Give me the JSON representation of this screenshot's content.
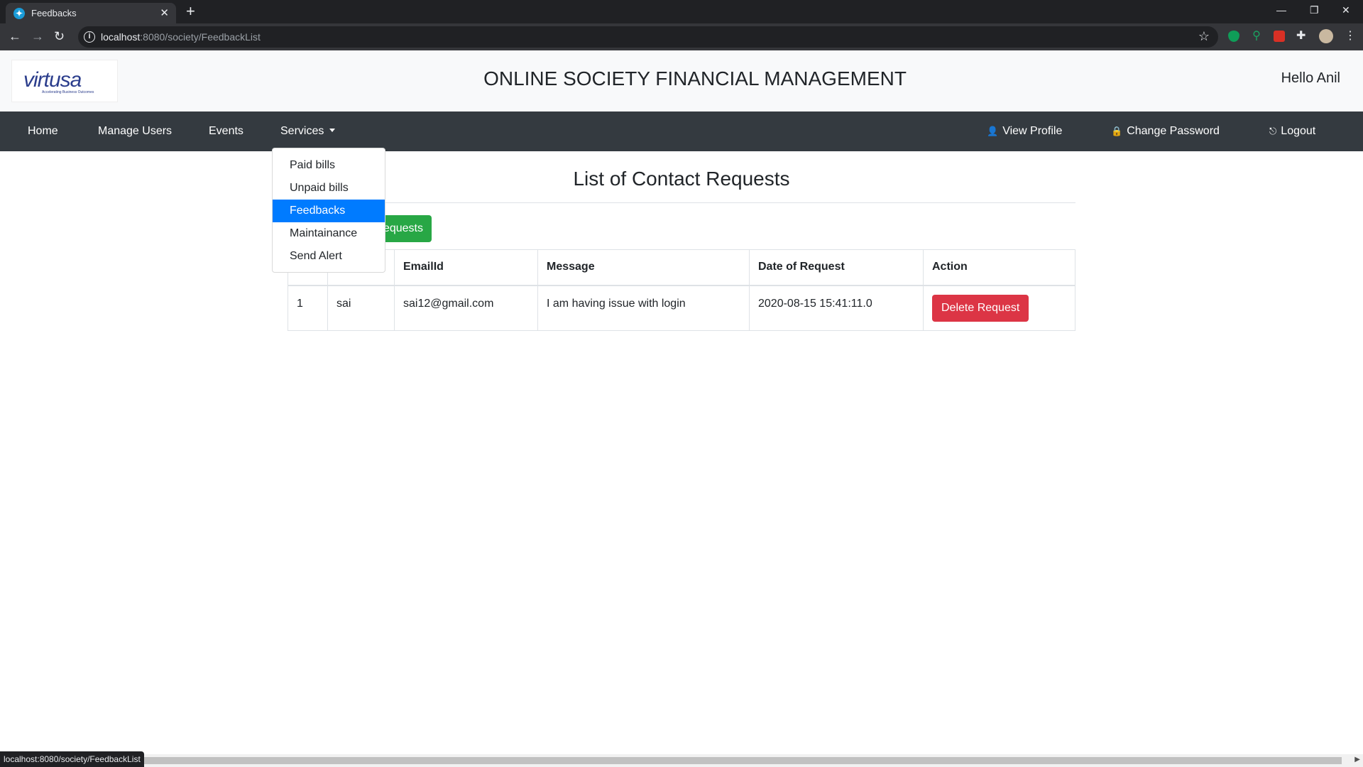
{
  "browser": {
    "tab_title": "Feedbacks",
    "tab_close": "✕",
    "new_tab": "+",
    "url_host": "localhost",
    "url_path": ":8080/society/FeedbackList",
    "status_url": "localhost:8080/society/FeedbackList",
    "win_minimize": "—",
    "win_restore": "❐",
    "win_close": "✕"
  },
  "header": {
    "logo_text": "virtusa",
    "logo_tagline": "Accelerating Business Outcomes",
    "title": "ONLINE SOCIETY FINANCIAL MANAGEMENT",
    "greeting": "Hello Anil"
  },
  "nav": {
    "home": "Home",
    "manage_users": "Manage Users",
    "events": "Events",
    "services": "Services",
    "view_profile": "View Profile",
    "change_password": "Change Password",
    "logout": "Logout"
  },
  "services_menu": {
    "items": [
      "Paid bills",
      "Unpaid bills",
      "Feedbacks",
      "Maintainance",
      "Send Alert"
    ],
    "active": "Feedbacks"
  },
  "main": {
    "title": "List of Contact Requests",
    "green_button_visible": "equests"
  },
  "table": {
    "headers": [
      "",
      "",
      "EmailId",
      "Message",
      "Date of Request",
      "Action"
    ],
    "rows": [
      {
        "id": "1",
        "name": "sai",
        "email": "sai12@gmail.com",
        "message": "I am having issue with login",
        "date": "2020-08-15 15:41:11.0",
        "action": "Delete Request"
      }
    ]
  },
  "colors": {
    "navbar": "#343a40",
    "header_bg": "#f8f9fa",
    "active_item": "#007bff",
    "success": "#28a745",
    "danger": "#dc3545"
  }
}
